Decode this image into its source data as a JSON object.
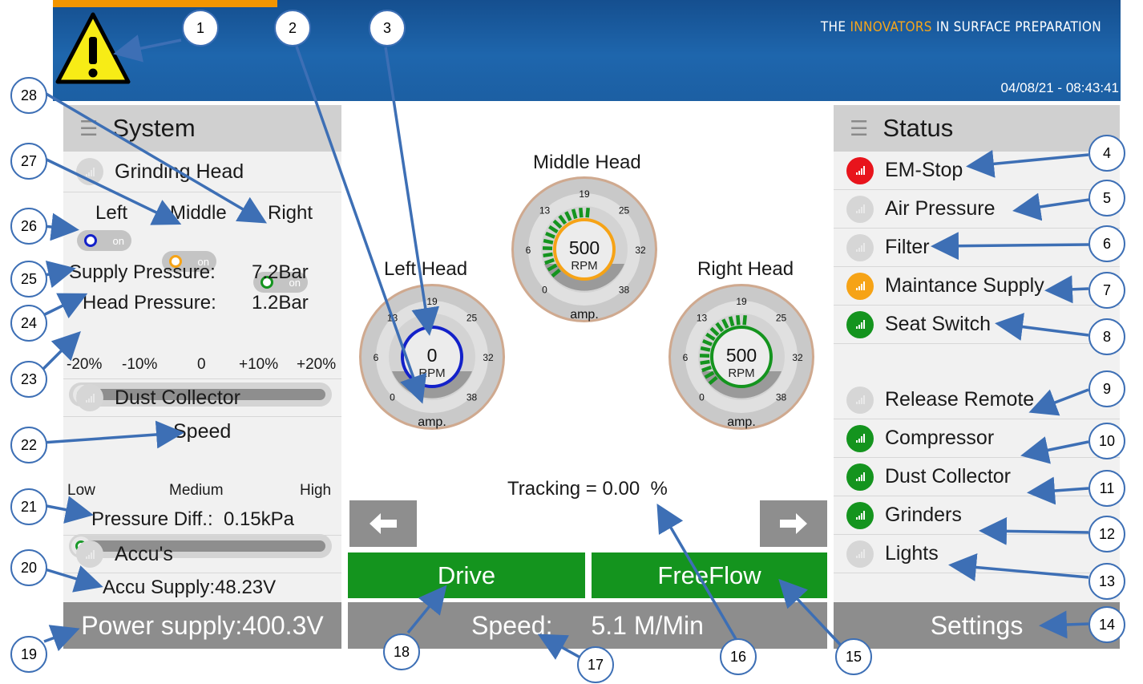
{
  "header": {
    "tagline_pre": "THE ",
    "tagline_hl": "INNOVATORS",
    "tagline_post": " IN SURFACE PREPARATION",
    "datetime": "04/08/21 - 08:43:41"
  },
  "system": {
    "title": "System",
    "grinding_head": "Grinding Head",
    "heads": [
      "Left",
      "Middle",
      "Right"
    ],
    "toggle_label": "on",
    "supply_pressure_label": "Supply Pressure:",
    "supply_pressure_value": "7.2Bar",
    "head_pressure_label": "Head Pressure:",
    "head_pressure_value": "1.2Bar",
    "pressure_scale": [
      "-20%",
      "-10%",
      "0",
      "+10%",
      "+20%"
    ],
    "dust_collector": "Dust Collector",
    "speed_label": "Speed",
    "speed_scale": [
      "Low",
      "Medium",
      "High"
    ],
    "pressure_diff": "Pressure Diff.:  0.15kPa",
    "accus": "Accu's",
    "accu_supply": "Accu Supply:48.23V",
    "power_supply": "Power supply:400.3V"
  },
  "gauges": {
    "ticks": [
      "0",
      "6",
      "13",
      "19",
      "25",
      "32",
      "38"
    ],
    "amp": "amp.",
    "rpm_unit": "RPM",
    "left": {
      "title": "Left Head",
      "rpm": "0",
      "color": "#1321c9",
      "level": 0
    },
    "middle": {
      "title": "Middle Head",
      "rpm": "500",
      "color": "#f6a316",
      "level": 0.55
    },
    "right": {
      "title": "Right Head",
      "rpm": "500",
      "color": "#14941e",
      "level": 0.55
    }
  },
  "tracking": {
    "label": "Tracking = 0.00  %",
    "value": 0.0
  },
  "buttons": {
    "drive": "Drive",
    "freeflow": "FreeFlow",
    "speed_label": "Speed:",
    "speed_value": "5.1 M/Min"
  },
  "status": {
    "title": "Status",
    "items": [
      {
        "label": "EM-Stop",
        "color": "red"
      },
      {
        "label": "Air Pressure",
        "color": "gray"
      },
      {
        "label": "Filter",
        "color": "gray"
      },
      {
        "label": "Maintance Supply",
        "color": "orange"
      },
      {
        "label": "Seat Switch",
        "color": "green"
      }
    ],
    "items2": [
      {
        "label": "Release Remote",
        "color": "gray"
      },
      {
        "label": "Compressor",
        "color": "green"
      },
      {
        "label": "Dust Collector",
        "color": "green"
      },
      {
        "label": "Grinders",
        "color": "green"
      },
      {
        "label": "Lights",
        "color": "gray"
      }
    ],
    "settings": "Settings"
  },
  "callouts": [
    "1",
    "2",
    "3",
    "4",
    "5",
    "6",
    "7",
    "8",
    "9",
    "10",
    "11",
    "12",
    "13",
    "14",
    "15",
    "16",
    "17",
    "18",
    "19",
    "20",
    "21",
    "22",
    "23",
    "24",
    "25",
    "26",
    "27",
    "28"
  ],
  "icons": [
    "warning-icon",
    "menu-icon",
    "signal-bars-icon",
    "left-arrow-icon",
    "right-arrow-icon"
  ]
}
